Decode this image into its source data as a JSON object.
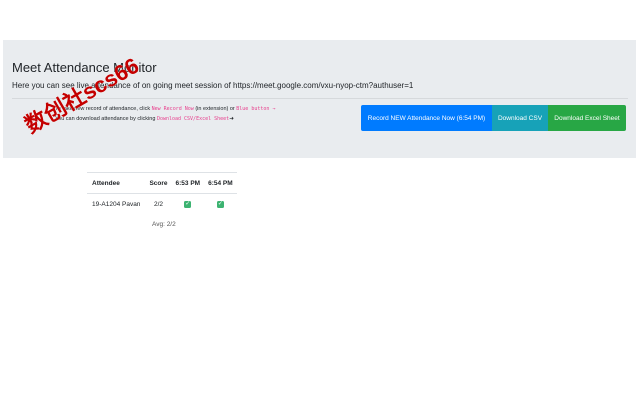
{
  "header": {
    "title": "Meet Attendance Monitor",
    "lead": "Here you can see live attendance of on going meet session of https://meet.google.com/vxu-nyop-ctm?authuser=1"
  },
  "instructions": {
    "line1_pre": "To take new record of attendance, click",
    "line1_code1": "New Record Now",
    "line1_mid": "(in extension) or",
    "line1_code2": "Blue button →",
    "line2_pre": "You can download attendance by clicking",
    "line2_code": "Download CSV/Excel Sheet",
    "line2_arrow": "➜"
  },
  "buttons": {
    "record": "Record NEW Attendance Now (6:54 PM)",
    "csv": "Download CSV",
    "excel": "Download Excel Sheet"
  },
  "table": {
    "headers": [
      "Attendee",
      "Score",
      "6:53 PM",
      "6:54 PM"
    ],
    "rows": [
      {
        "attendee": "19-A1204 Pavan",
        "score": "2/2",
        "c1": "✓",
        "c2": "✓"
      }
    ],
    "avg": "Avg: 2/2"
  },
  "watermark": "数创社scs66",
  "colors": {
    "primary": "#007bff",
    "info": "#17a2b8",
    "success": "#28a745",
    "code": "#e83e8c",
    "jumbotron": "#e9ecef"
  }
}
